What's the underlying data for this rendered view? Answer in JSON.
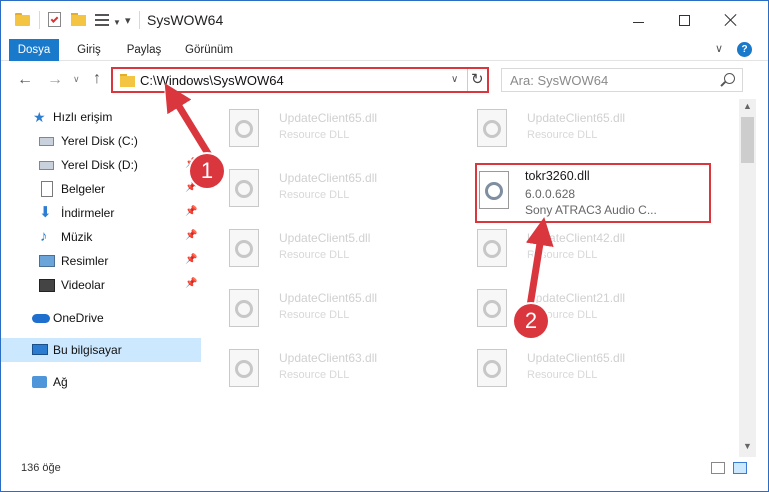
{
  "window": {
    "title": "SysWOW64"
  },
  "ribbon": {
    "tabs": [
      "Dosya",
      "Giriş",
      "Paylaş",
      "Görünüm"
    ],
    "help": "?"
  },
  "nav": {
    "address": "C:\\Windows\\SysWOW64",
    "search_placeholder": "Ara: SysWOW64"
  },
  "sidebar": {
    "items": [
      {
        "label": "Hızlı erişim",
        "icon": "star-icon"
      },
      {
        "label": "Yerel Disk (C:)",
        "icon": "disk-icon",
        "pinned": true
      },
      {
        "label": "Yerel Disk (D:)",
        "icon": "disk-icon",
        "pinned": true
      },
      {
        "label": "Belgeler",
        "icon": "document-icon",
        "pinned": true
      },
      {
        "label": "İndirmeler",
        "icon": "download-icon",
        "pinned": true
      },
      {
        "label": "Müzik",
        "icon": "music-icon",
        "pinned": true
      },
      {
        "label": "Resimler",
        "icon": "pictures-icon",
        "pinned": true
      },
      {
        "label": "Videolar",
        "icon": "videos-icon",
        "pinned": true
      },
      {
        "label": "OneDrive",
        "icon": "onedrive-icon"
      },
      {
        "label": "Bu bilgisayar",
        "icon": "this-pc-icon",
        "selected": true
      },
      {
        "label": "Ağ",
        "icon": "network-icon"
      }
    ]
  },
  "files": {
    "left": [
      {
        "name": "UpdateClient65.dll",
        "type": "Resource DLL"
      },
      {
        "name": "UpdateClient65.dll",
        "type": "Resource DLL"
      },
      {
        "name": "UpdateClient5.dll",
        "type": "Resource DLL"
      },
      {
        "name": "UpdateClient65.dll",
        "type": "Resource DLL"
      },
      {
        "name": "UpdateClient63.dll",
        "type": "Resource DLL"
      }
    ],
    "right": [
      {
        "name": "UpdateClient65.dll",
        "type": "Resource DLL"
      },
      {
        "name": "UpdateClient42.dll",
        "type": "Resource DLL"
      },
      {
        "name": "UpdateClient21.dll",
        "type": "Resource DLL"
      },
      {
        "name": "UpdateClient65.dll",
        "type": "Resource DLL"
      }
    ],
    "highlighted": {
      "name": "tokr3260.dll",
      "version": "6.0.0.628",
      "description": "Sony ATRAC3 Audio C..."
    }
  },
  "status": {
    "count": "136 öğe"
  },
  "annotations": {
    "step1": "1",
    "step2": "2",
    "color": "#d9363e"
  }
}
